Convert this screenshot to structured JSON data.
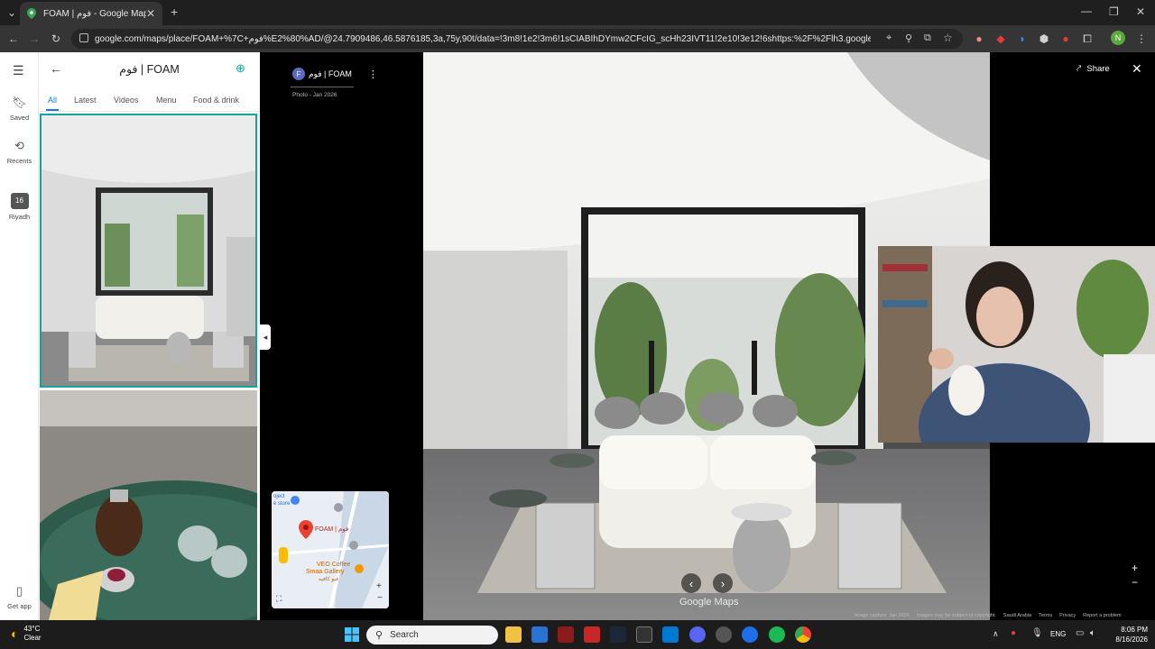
{
  "browser": {
    "tab_title": "FOAM | فوم - Google Maps",
    "url": "google.com/maps/place/FOAM+%7C+فوم%E2%80%AD/@24.7909486,46.5876185,3a,75y,90t/data=!3m8!1e2!3m6!1sCIABIhDYmw2CFcIG_scHh23IVT11!2e10!3e12!6shttps:%2F%2Flh3.googleusercontent.com%...",
    "profile_initial": "N"
  },
  "rail": {
    "saved": "Saved",
    "recents": "Recents",
    "recent_city": "Riyadh",
    "recent_badge": "16",
    "get_app": "Get app"
  },
  "panel": {
    "title": "فوم | FOAM",
    "tabs": [
      "All",
      "Latest",
      "Videos",
      "Menu",
      "Food & drink"
    ]
  },
  "viewer": {
    "avatar_letter": "F",
    "place_name": "فوم | FOAM",
    "photo_date": "Photo - Jan 2026",
    "share_label": "Share",
    "logo": "Google Maps",
    "footer": [
      "Image capture: Jan 2026",
      "Images may be subject to copyright.",
      "Saudi Arabia",
      "Terms",
      "Privacy",
      "Report a problem"
    ]
  },
  "minimap": {
    "pin_label": "FOAM | فوم",
    "nearby": "VEO Coffee",
    "nearby2": "Smaa Gallery",
    "nearby_ar": "فيو كافيه",
    "corner_text": "oject",
    "corner_text2": "e store"
  },
  "taskbar": {
    "temperature": "43°C",
    "condition": "Clear",
    "search_placeholder": "Search",
    "language": "ENG",
    "time": "8:06 PM",
    "date": "8/16/2026"
  },
  "colors": {
    "accent_teal": "#14a49c",
    "link_blue": "#1a73e8",
    "pin_red": "#ea4335"
  }
}
